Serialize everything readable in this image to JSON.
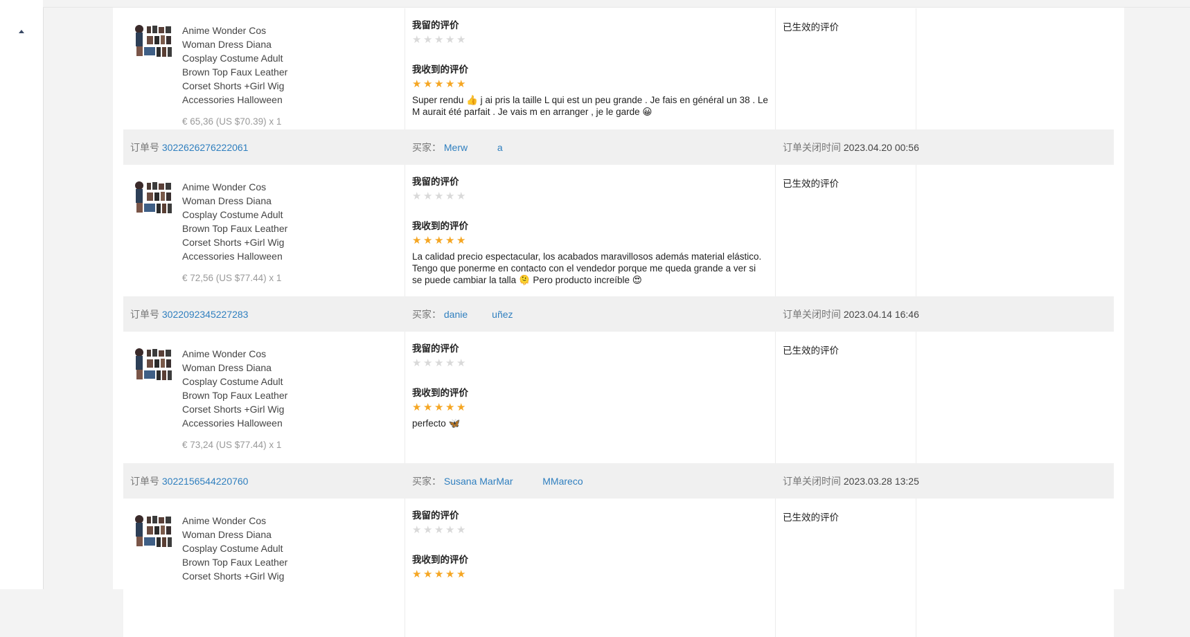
{
  "sidebar": {
    "collapse_icon": "caret-up-icon"
  },
  "labels": {
    "order_no": "订单号",
    "buyer": "买家：",
    "close_time": "订单关闭时间",
    "my_review": "我留的评价",
    "received_review": "我收到的评价",
    "review_effective": "已生效的评价"
  },
  "colors": {
    "accent_link": "#2f7fbf",
    "star_gold": "#f5a623",
    "star_gray": "#d9d9d9"
  },
  "orders": [
    {
      "order_no": "",
      "buyer": "",
      "close_time": "",
      "product_title": "Anime Wonder Cos Woman Dress Diana Cosplay Costume Adult Brown Top Faux Leather Corset Shorts +Girl Wig Accessories Halloween",
      "price": "€ 65,36 (US $70.39) x 1",
      "my_rating": 0,
      "received_rating": 5,
      "review_text": "Super rendu 👍 j ai pris la taille L qui est un peu grande . Je fais en général un 38 . Le M aurait été parfait . Je vais m en arranger , je le garde 😀",
      "status": "已生效的评价"
    },
    {
      "order_no": "3022626276222061",
      "buyer": "Merw           a",
      "close_time": "2023.04.20 00:56",
      "product_title": "Anime Wonder Cos Woman Dress Diana Cosplay Costume Adult Brown Top Faux Leather Corset Shorts +Girl Wig Accessories Halloween",
      "price": "€ 72,56 (US $77.44) x 1",
      "my_rating": 0,
      "received_rating": 5,
      "review_text": "La calidad precio espectacular, los acabados maravillosos además material elástico. Tengo que ponerme en contacto con el vendedor porque me queda grande a ver si se puede cambiar la talla 🫠 Pero producto increíble 😍",
      "status": "已生效的评价"
    },
    {
      "order_no": "3022092345227283",
      "buyer": "danie         uñez",
      "close_time": "2023.04.14 16:46",
      "product_title": "Anime Wonder Cos Woman Dress Diana Cosplay Costume Adult Brown Top Faux Leather Corset Shorts +Girl Wig Accessories Halloween",
      "price": "€ 73,24 (US $77.44) x 1",
      "my_rating": 0,
      "received_rating": 5,
      "review_text": "perfecto 🦋",
      "status": "已生效的评价"
    },
    {
      "order_no": "3022156544220760",
      "buyer": "Susana MarMar           MMareco",
      "close_time": "2023.03.28 13:25",
      "product_title": "Anime Wonder Cos Woman Dress Diana Cosplay Costume Adult Brown Top Faux Leather Corset Shorts +Girl Wig",
      "price": "",
      "my_rating": 0,
      "received_rating": 5,
      "review_text": "",
      "status": "已生效的评价"
    }
  ]
}
